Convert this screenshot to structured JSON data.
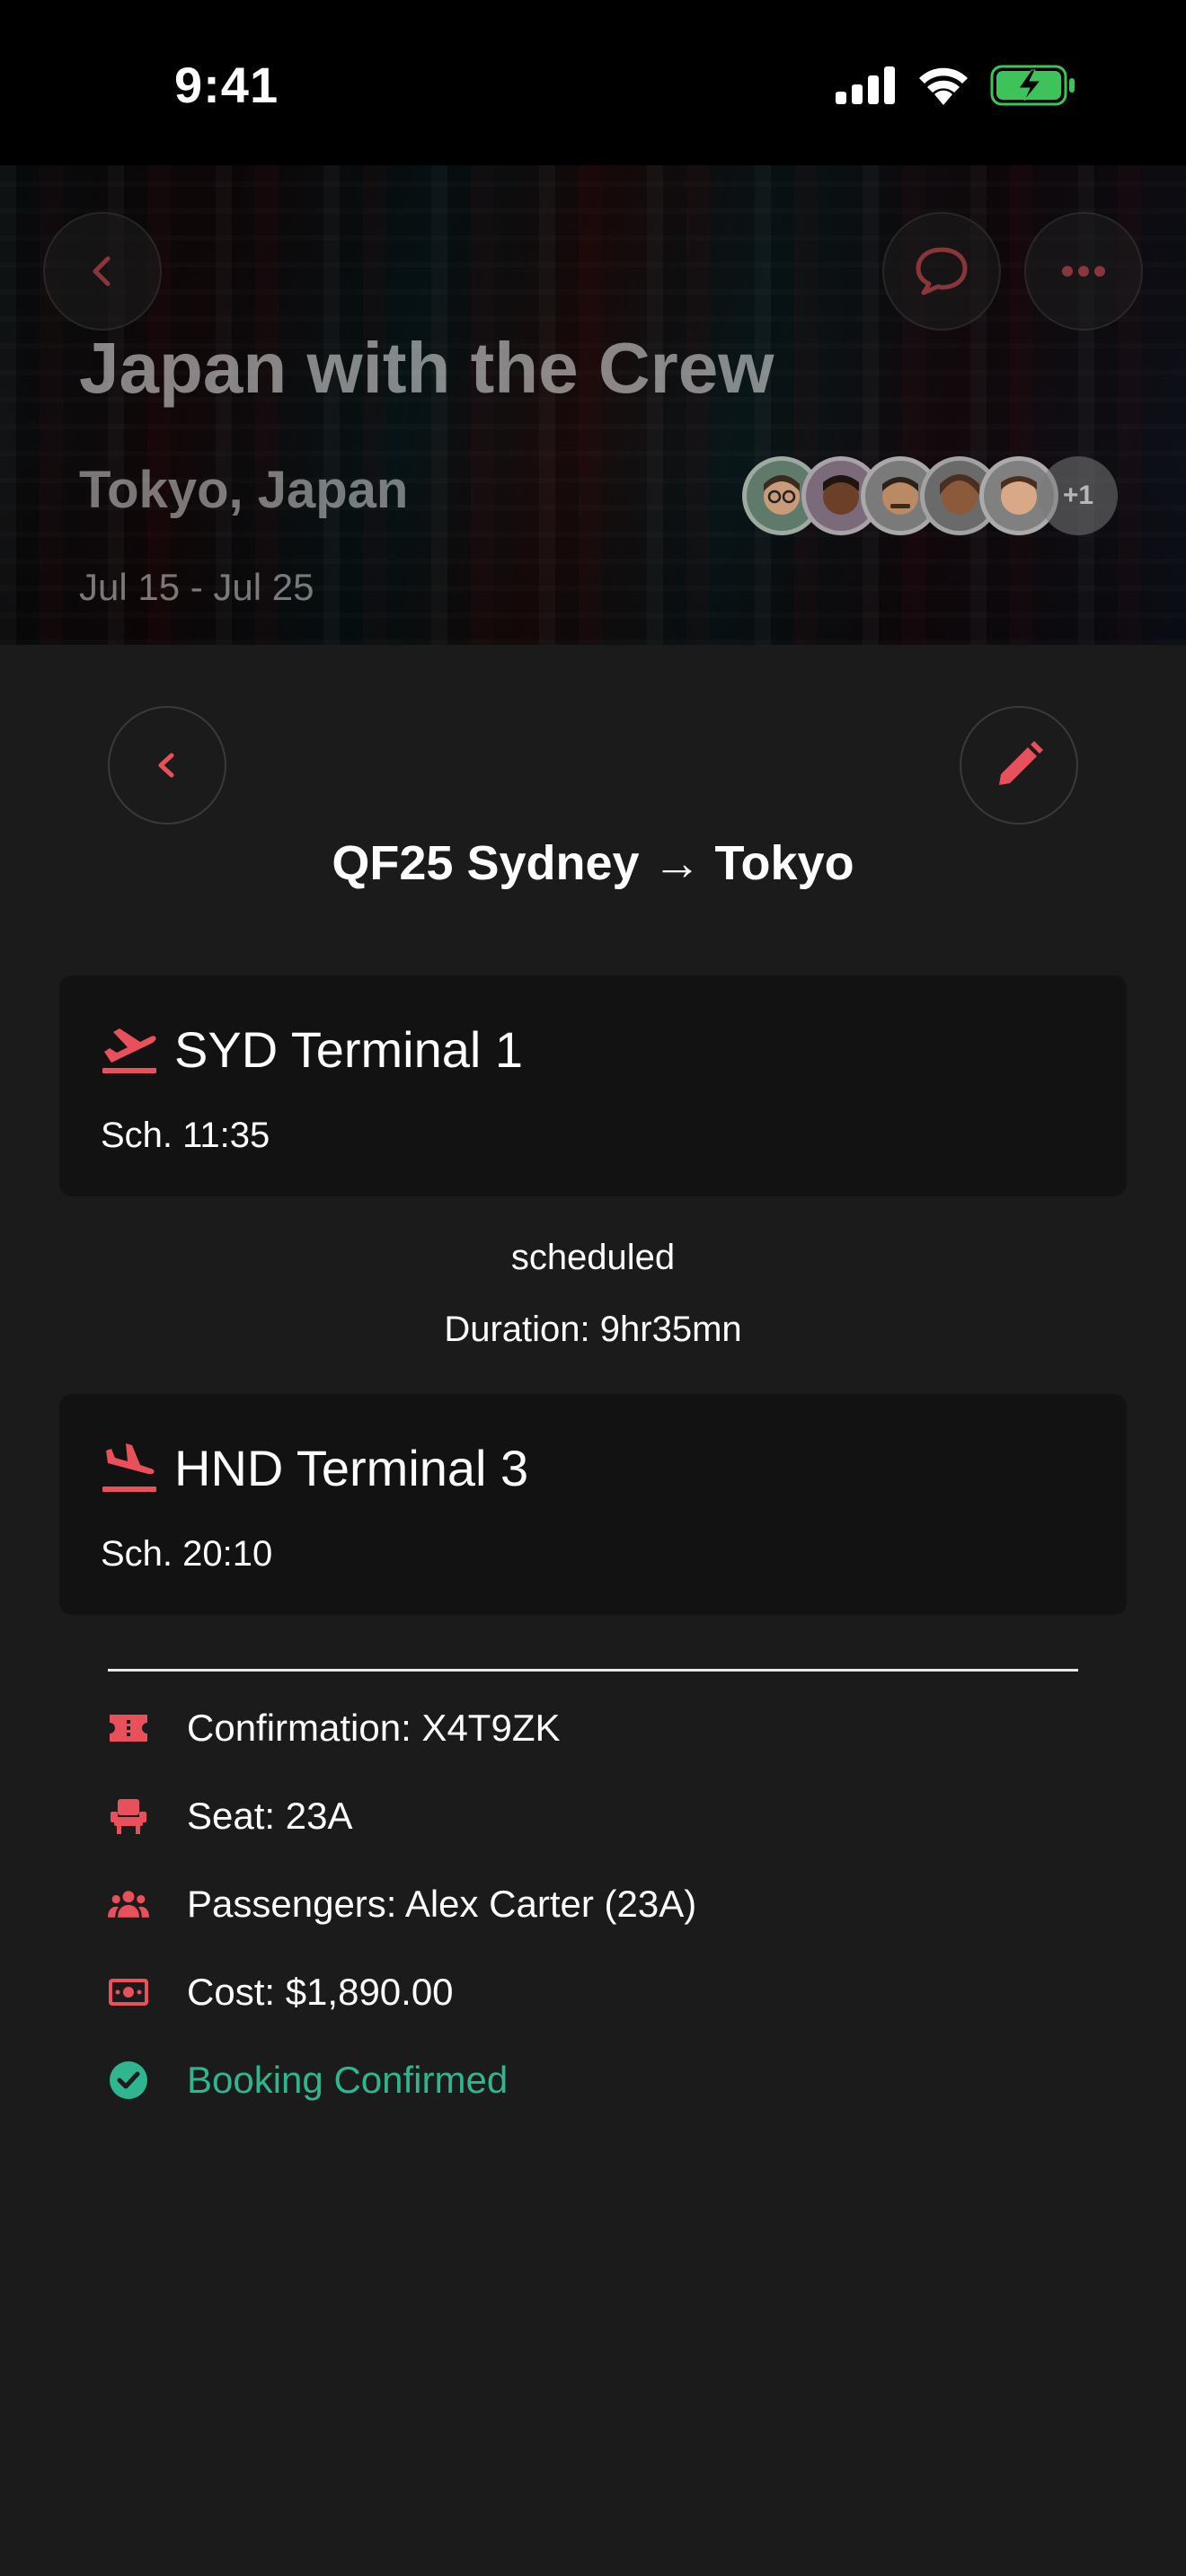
{
  "status_bar": {
    "time": "9:41"
  },
  "trip": {
    "title": "Japan with the Crew",
    "location": "Tokyo, Japan",
    "dates": "Jul 15 - Jul 25",
    "extra_members": "+1"
  },
  "flight": {
    "title": "QF25 Sydney → Tokyo",
    "departure": {
      "airport": "SYD Terminal 1",
      "scheduled": "Sch. 11:35"
    },
    "status": "scheduled",
    "duration": "Duration: 9hr35mn",
    "arrival": {
      "airport": "HND Terminal 3",
      "scheduled": "Sch. 20:10"
    }
  },
  "details": {
    "confirmation": "Confirmation: X4T9ZK",
    "seat": "Seat: 23A",
    "passengers": "Passengers: Alex Carter (23A)",
    "cost": "Cost: $1,890.00",
    "booking_status": "Booking Confirmed"
  },
  "colors": {
    "accent": "#e8505b",
    "success": "#2fb58f",
    "background": "#1b1b1b",
    "card": "#121212"
  }
}
